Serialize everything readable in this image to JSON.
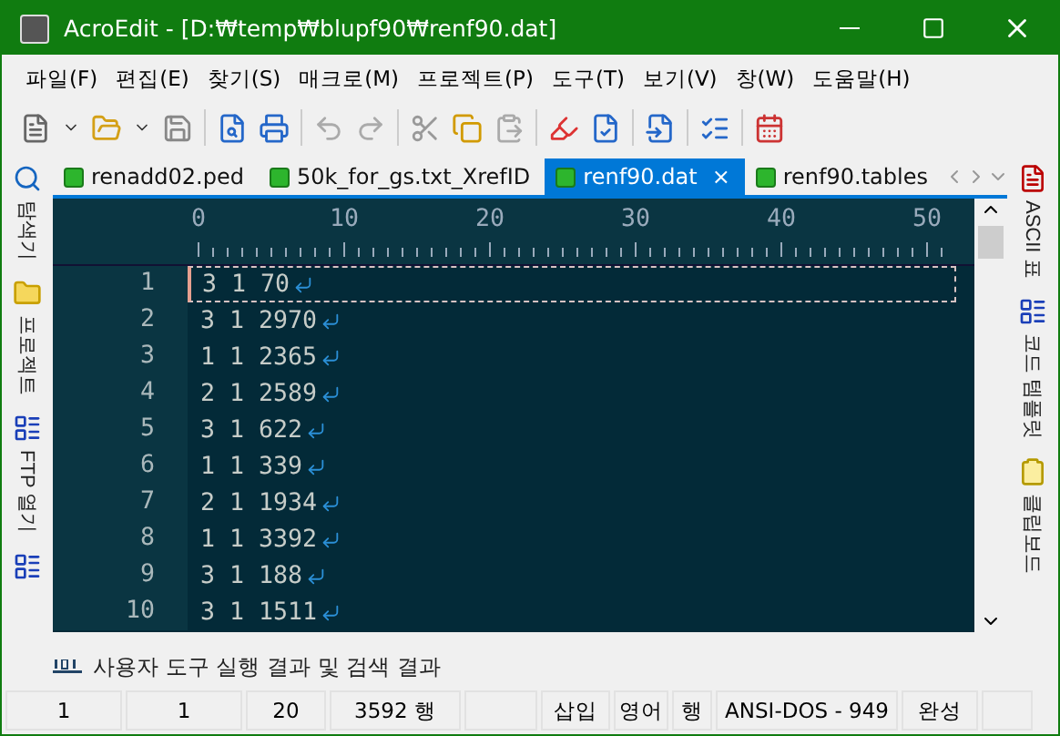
{
  "window": {
    "title": "AcroEdit - [D:₩temp₩blupf90₩renf90.dat]"
  },
  "menu": [
    "파일(F)",
    "편집(E)",
    "찾기(S)",
    "매크로(M)",
    "프로젝트(P)",
    "도구(T)",
    "보기(V)",
    "창(W)",
    "도움말(H)"
  ],
  "left_panel": [
    {
      "label": "탐색기",
      "kind": "search"
    },
    {
      "label": "프로젝트",
      "kind": "folder"
    },
    {
      "label": "FTP 열기",
      "kind": "ftp"
    },
    {
      "kind": "tree"
    }
  ],
  "right_panel": [
    {
      "label": "ASCII 표",
      "kind": "ascii"
    },
    {
      "label": "코드 템플릿",
      "kind": "template"
    },
    {
      "label": "클립보드",
      "kind": "clipboard"
    }
  ],
  "tabs": [
    {
      "label": "renadd02.ped",
      "selected": false
    },
    {
      "label": "50k_for_gs.txt_XrefID",
      "selected": false
    },
    {
      "label": "renf90.dat",
      "selected": true,
      "close": "×"
    },
    {
      "label": "renf90.tables",
      "selected": false
    }
  ],
  "ruler": [
    "0",
    "10",
    "20",
    "30",
    "40",
    "50"
  ],
  "lines": [
    {
      "number": "1",
      "text": "3 1 70",
      "current": true
    },
    {
      "number": "2",
      "text": "3 1 2970",
      "current": false
    },
    {
      "number": "3",
      "text": "1 1 2365",
      "current": false
    },
    {
      "number": "4",
      "text": "2 1 2589",
      "current": false
    },
    {
      "number": "5",
      "text": "3 1 622",
      "current": false
    },
    {
      "number": "6",
      "text": "1 1 339",
      "current": false
    },
    {
      "number": "7",
      "text": "2 1 1934",
      "current": false
    },
    {
      "number": "8",
      "text": "1 1 3392",
      "current": false
    },
    {
      "number": "9",
      "text": "3 1 188",
      "current": false
    },
    {
      "number": "10",
      "text": "3 1 1511",
      "current": false
    }
  ],
  "output_panel": {
    "label": "사용자 도구 실행 결과 및 검색 결과"
  },
  "status_bar": [
    "1",
    "1",
    "20",
    "3592 행",
    "삽입",
    "영어",
    "행",
    "ANSI-DOS - 949",
    "완성"
  ]
}
